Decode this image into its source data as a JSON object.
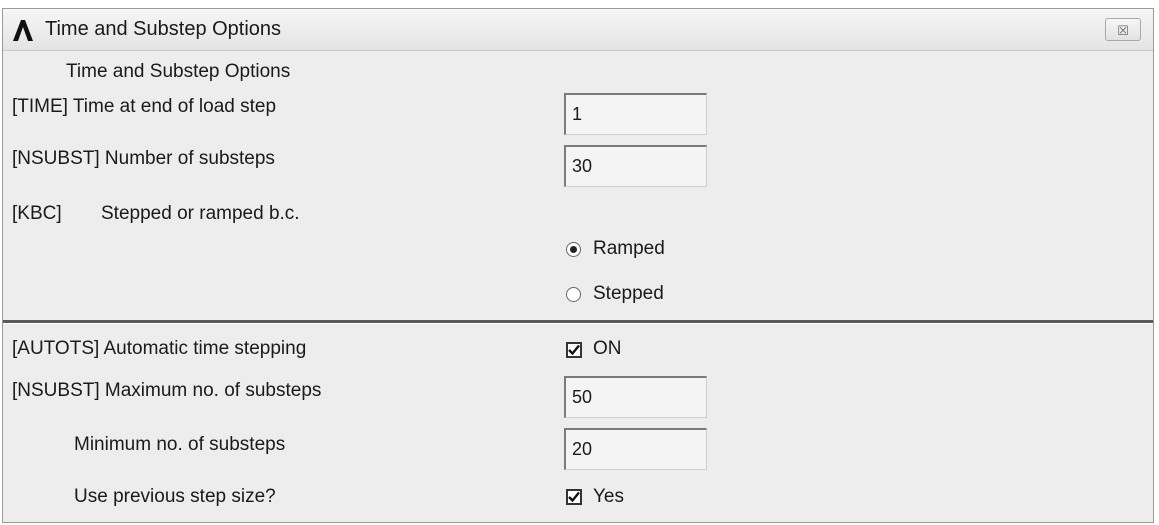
{
  "window": {
    "title": "Time and Substep Options",
    "close_symbol": "☒"
  },
  "section1": {
    "heading": "Time and Substep Options",
    "time_label": "[TIME]  Time at end of load step",
    "time_value": "1",
    "nsubst_label": "[NSUBST]  Number of substeps",
    "nsubst_value": "30",
    "kbc_label": "[KBC]",
    "kbc_desc": "Stepped or ramped b.c.",
    "ramped_label": "Ramped",
    "stepped_label": "Stepped",
    "ramped_selected": true
  },
  "section2": {
    "autots_label": "[AUTOTS] Automatic time stepping",
    "on_label": "ON",
    "on_checked": true,
    "max_label": "[NSUBST] Maximum no. of substeps",
    "max_value": "50",
    "min_label": "Minimum no. of substeps",
    "min_value": "20",
    "prev_label": "Use previous step size?",
    "yes_label": "Yes",
    "yes_checked": true
  }
}
